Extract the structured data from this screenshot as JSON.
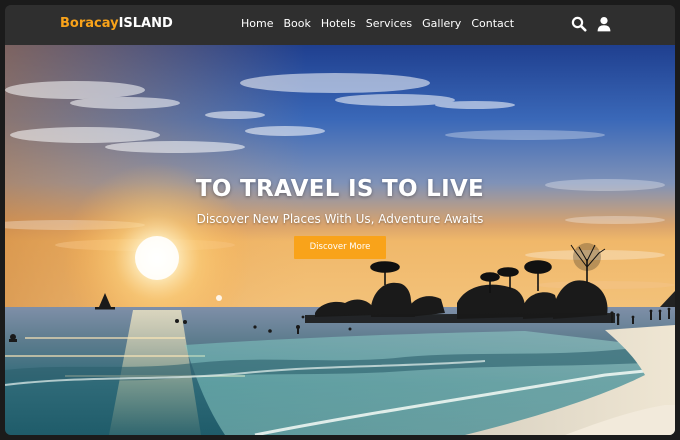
{
  "brand": {
    "part1": "Boracay",
    "part2": "ISLAND"
  },
  "nav": {
    "items": [
      "Home",
      "Book",
      "Hotels",
      "Services",
      "Gallery",
      "Contact"
    ]
  },
  "icons": {
    "search": "search-icon",
    "user": "user-icon"
  },
  "hero": {
    "title": "TO TRAVEL IS TO LIVE",
    "subtitle": "Discover New Places With Us, Adventure Awaits",
    "cta_label": "Discover More"
  },
  "colors": {
    "accent": "#f9a31a",
    "topbar": "#2f2f2f",
    "text": "#ffffff"
  }
}
